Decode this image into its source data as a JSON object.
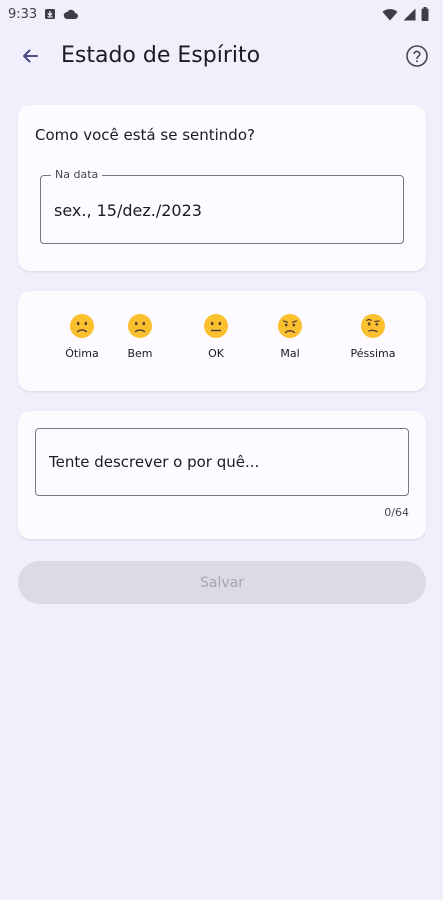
{
  "status_bar": {
    "time": "9:33",
    "notification_icons": [
      "download-box-icon",
      "cloud-icon"
    ],
    "system_icons": [
      "wifi-icon",
      "signal-icon",
      "battery-icon"
    ]
  },
  "app_bar": {
    "back_icon": "arrow-left-icon",
    "title": "Estado de Espírito",
    "help_icon": "help-circle-icon"
  },
  "date_card": {
    "question": "Como você está se sentindo?",
    "date_field": {
      "label": "Na data",
      "value": "sex., 15/dez./2023"
    }
  },
  "mood_card": {
    "moods": [
      {
        "label": "Ótima",
        "icon": "slightly-frowning-face-icon"
      },
      {
        "label": "Bem",
        "icon": "slightly-frowning-face-icon"
      },
      {
        "label": "OK",
        "icon": "neutral-face-icon"
      },
      {
        "label": "Mal",
        "icon": "worried-face-icon"
      },
      {
        "label": "Péssima",
        "icon": "face-with-raised-eyebrow-icon"
      }
    ]
  },
  "reason_card": {
    "placeholder": "Tente descrever o por quê...",
    "value": "",
    "char_count": "0/64"
  },
  "actions": {
    "save_label": "Salvar"
  },
  "colors": {
    "background": "#f2effc",
    "card": "#fdfbff",
    "emoji_face": "#fbc02d",
    "disabled_button": "#dcdae3",
    "disabled_text": "#a7a5ad"
  }
}
